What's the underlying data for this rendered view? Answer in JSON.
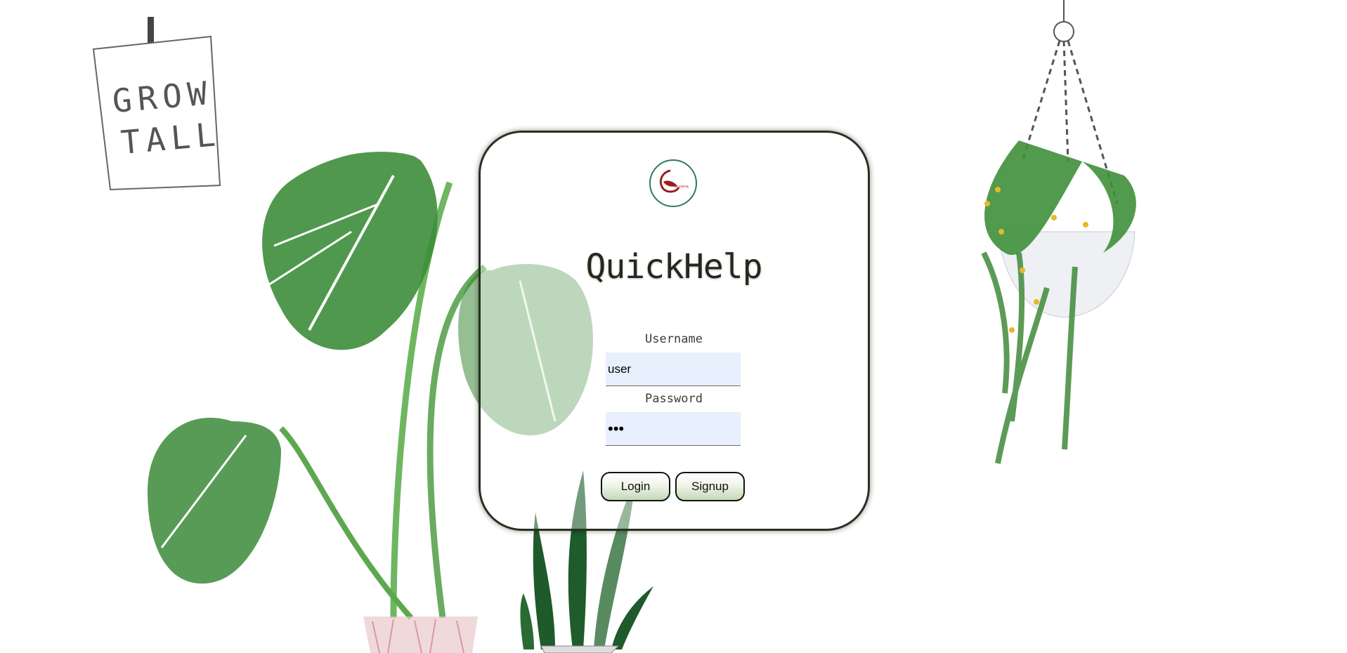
{
  "note_card": {
    "line1": "GROW",
    "line2": "TALL"
  },
  "logo": {
    "text": "QuickHelp",
    "ring_color": "#2f7b5c",
    "mark_color": "#9b1d20"
  },
  "login": {
    "title": "QuickHelp",
    "username_label": "Username",
    "username_value": "user",
    "password_label": "Password",
    "password_value": "•••",
    "login_button": "Login",
    "signup_button": "Signup"
  },
  "colors": {
    "card_border": "#25321f",
    "input_bg": "#e8f0fe",
    "leaf_green": "#3f8f3a",
    "leaf_dark": "#1f5a2a",
    "pot_pink": "#e9c9cb",
    "hanging_flower": "#e8b829"
  }
}
